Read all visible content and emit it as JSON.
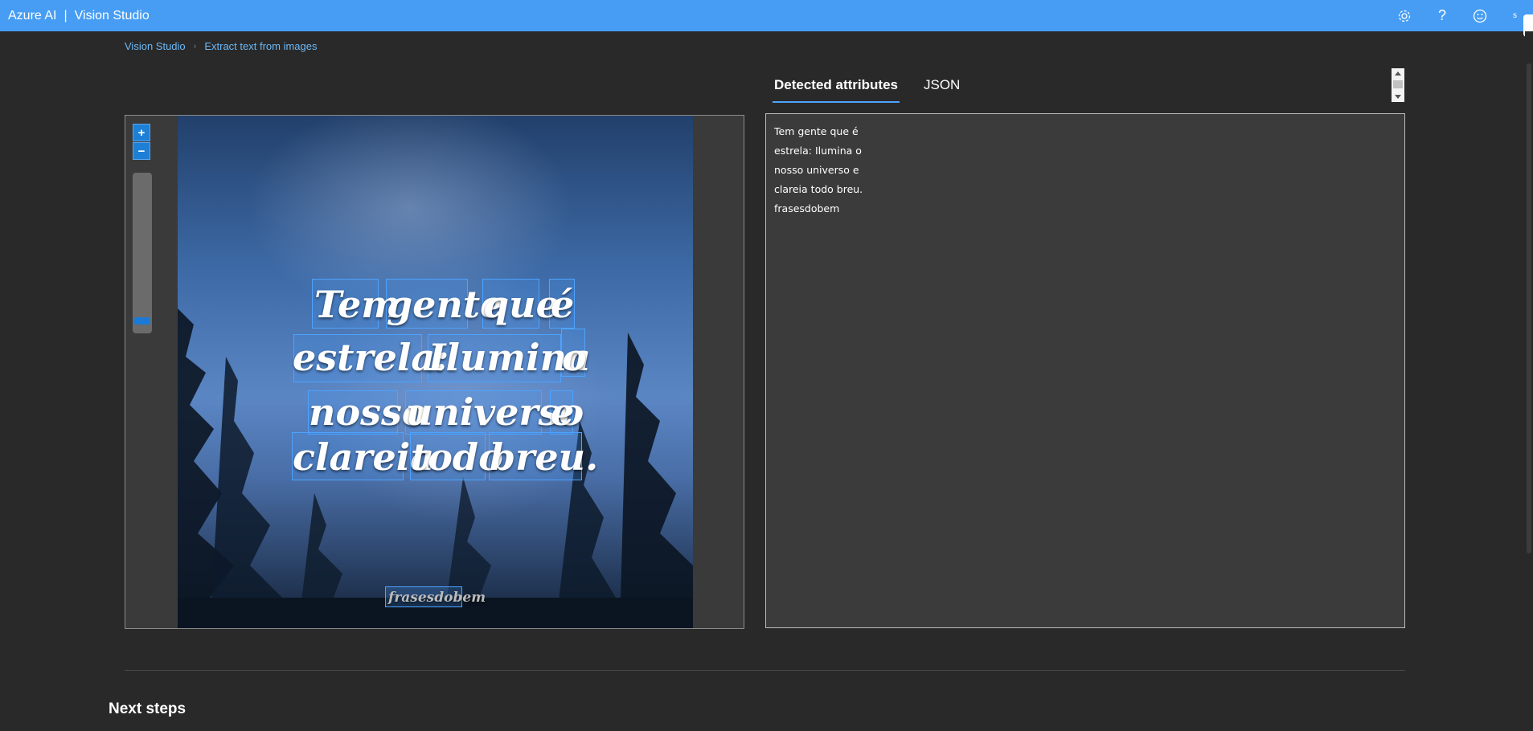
{
  "header": {
    "brand": "Azure AI",
    "separator": "|",
    "product": "Vision Studio",
    "icons": [
      "settings-gear-icon",
      "help-question-icon",
      "feedback-smiley-icon"
    ],
    "avatar_letter": "s"
  },
  "breadcrumb": [
    {
      "label": "Vision Studio"
    },
    {
      "label": "Extract text from images"
    }
  ],
  "image_viewer": {
    "zoom_in": "+",
    "zoom_out": "−",
    "zoom_level": 0.08,
    "watermark": "frasesdobem",
    "quote_lines": [
      [
        "Tem",
        "gente",
        "que",
        "é"
      ],
      [
        "estrela:",
        "Ilumina",
        "o"
      ],
      [
        "nosso",
        "universo",
        "e"
      ],
      [
        "clareia",
        "todo",
        "breu."
      ]
    ]
  },
  "tabs": [
    {
      "label": "Detected attributes",
      "active": true
    },
    {
      "label": "JSON",
      "active": false
    }
  ],
  "results": {
    "lines": [
      "Tem gente que é",
      "estrela: Ilumina o",
      "nosso universo e",
      "clareia todo breu.",
      "frasesdobem"
    ]
  },
  "next_steps": {
    "title": "Next steps"
  },
  "colors": {
    "topbar": "#469df3",
    "background": "#292929",
    "accent": "#4da3ff",
    "link": "#6cb8f6"
  }
}
